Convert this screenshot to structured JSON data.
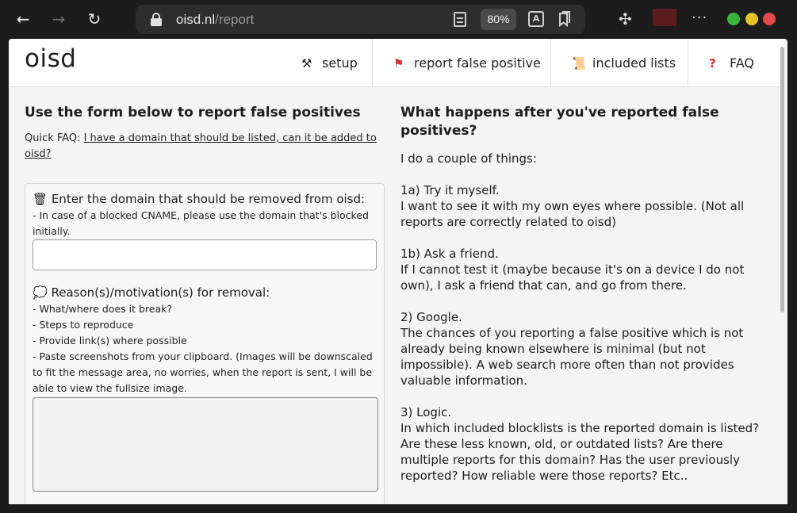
{
  "browser": {
    "url_host": "oisd.nl",
    "url_path": "/report",
    "zoom": "80%",
    "back_icon": "arrow-left-icon",
    "forward_icon": "arrow-right-icon",
    "reload_icon": "reload-icon",
    "more_icon": "ellipsis-icon"
  },
  "site": {
    "logo": "oisd",
    "nav": [
      {
        "icon": "⚒",
        "label": "setup"
      },
      {
        "icon": "⚑",
        "label": "report false positive"
      },
      {
        "icon": "📜",
        "label": "included lists"
      },
      {
        "icon": "?",
        "label": "FAQ"
      }
    ]
  },
  "form": {
    "heading": "Use the form below to report false positives",
    "quick_faq_prefix": "Quick FAQ:",
    "quick_faq_link": "I have a domain that should be listed, can it be added to oisd?",
    "domain_label_icon": "🗑",
    "domain_label": "Enter the domain that should be removed from oisd:",
    "domain_hint": "- In case of a blocked CNAME, please use the domain that's blocked initially.",
    "domain_value": "",
    "reason_label_icon": "💭",
    "reason_label": "Reason(s)/motivation(s) for removal:",
    "reason_hints": [
      "- What/where does it break?",
      "- Steps to reproduce",
      "- Provide link(s) where possible",
      "- Paste screenshots from your clipboard. (Images will be downscaled to fit the message area, no worries, when the report is sent, I will be able to view the fullsize image."
    ],
    "reason_value": ""
  },
  "info": {
    "heading": "What happens after you've reported false positives?",
    "intro": "I do a couple of things:",
    "steps": [
      {
        "title": "1a) Try it myself.",
        "body": "I want to see it with my own eyes where possible. (Not all reports are correctly related to oisd)"
      },
      {
        "title": "1b) Ask a friend.",
        "body": "If I cannot test it (maybe because it's on a device I do not own), I ask a friend that can, and go from there."
      },
      {
        "title": "2) Google.",
        "body": "The chances of you reporting a false positive which is not already being known elsewhere is minimal (but not impossible). A web search more often than not provides valuable information."
      },
      {
        "title": "3) Logic.",
        "body": "In which included blocklists is the reported domain is listed? Are these less known, old, or outdated lists? Are there multiple reports for this domain? Has the user previously reported? How reliable were those reports? Etc.."
      }
    ]
  }
}
